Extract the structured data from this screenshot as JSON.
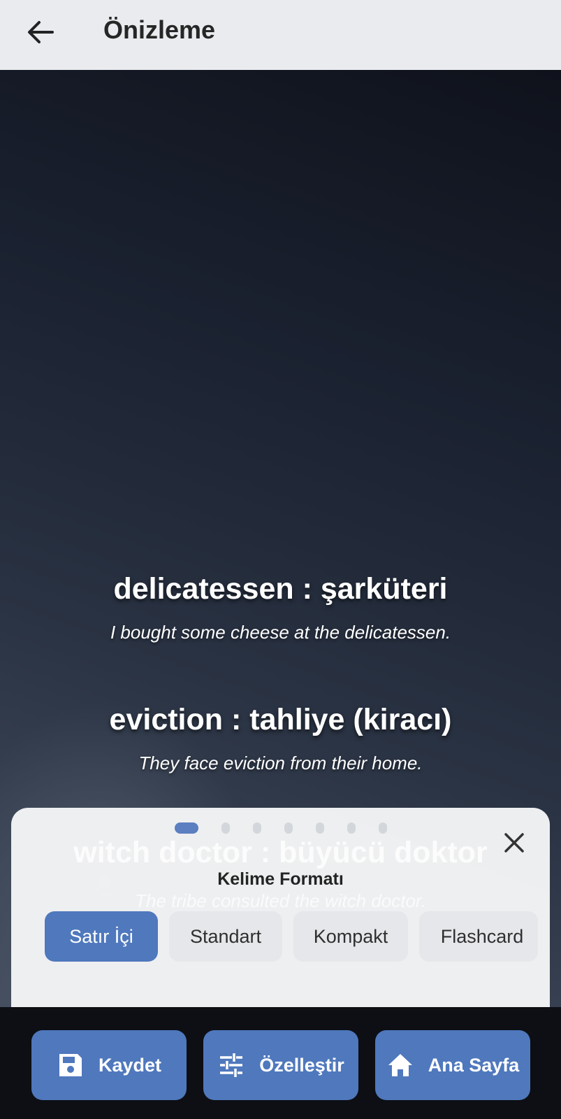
{
  "app_bar": {
    "title": "Önizleme",
    "back_icon": "arrow-left-icon"
  },
  "preview": {
    "entries": [
      {
        "word": "delicatessen : şarküteri",
        "example": "I bought some cheese at the delicatessen."
      },
      {
        "word": "eviction : tahliye (kiracı)",
        "example": "They face eviction from their home."
      },
      {
        "word": "witch doctor : büyücü doktor",
        "example": "The tribe consulted the witch doctor."
      }
    ]
  },
  "format_sheet": {
    "title": "Kelime Formatı",
    "page_count": 7,
    "active_page": 1,
    "close_icon": "close-icon",
    "options": [
      "Satır İçi",
      "Standart",
      "Kompakt",
      "Flashcard"
    ],
    "selected": "Satır İçi"
  },
  "actions": {
    "save": {
      "label": "Kaydet",
      "icon": "save-icon"
    },
    "customize": {
      "label": "Özelleştir",
      "icon": "tune-icon"
    },
    "home": {
      "label": "Ana Sayfa",
      "icon": "home-icon"
    }
  },
  "colors": {
    "accent": "#4f78bd",
    "app_bar": "#e9ebee",
    "bottom_bar": "#0d0f14"
  }
}
